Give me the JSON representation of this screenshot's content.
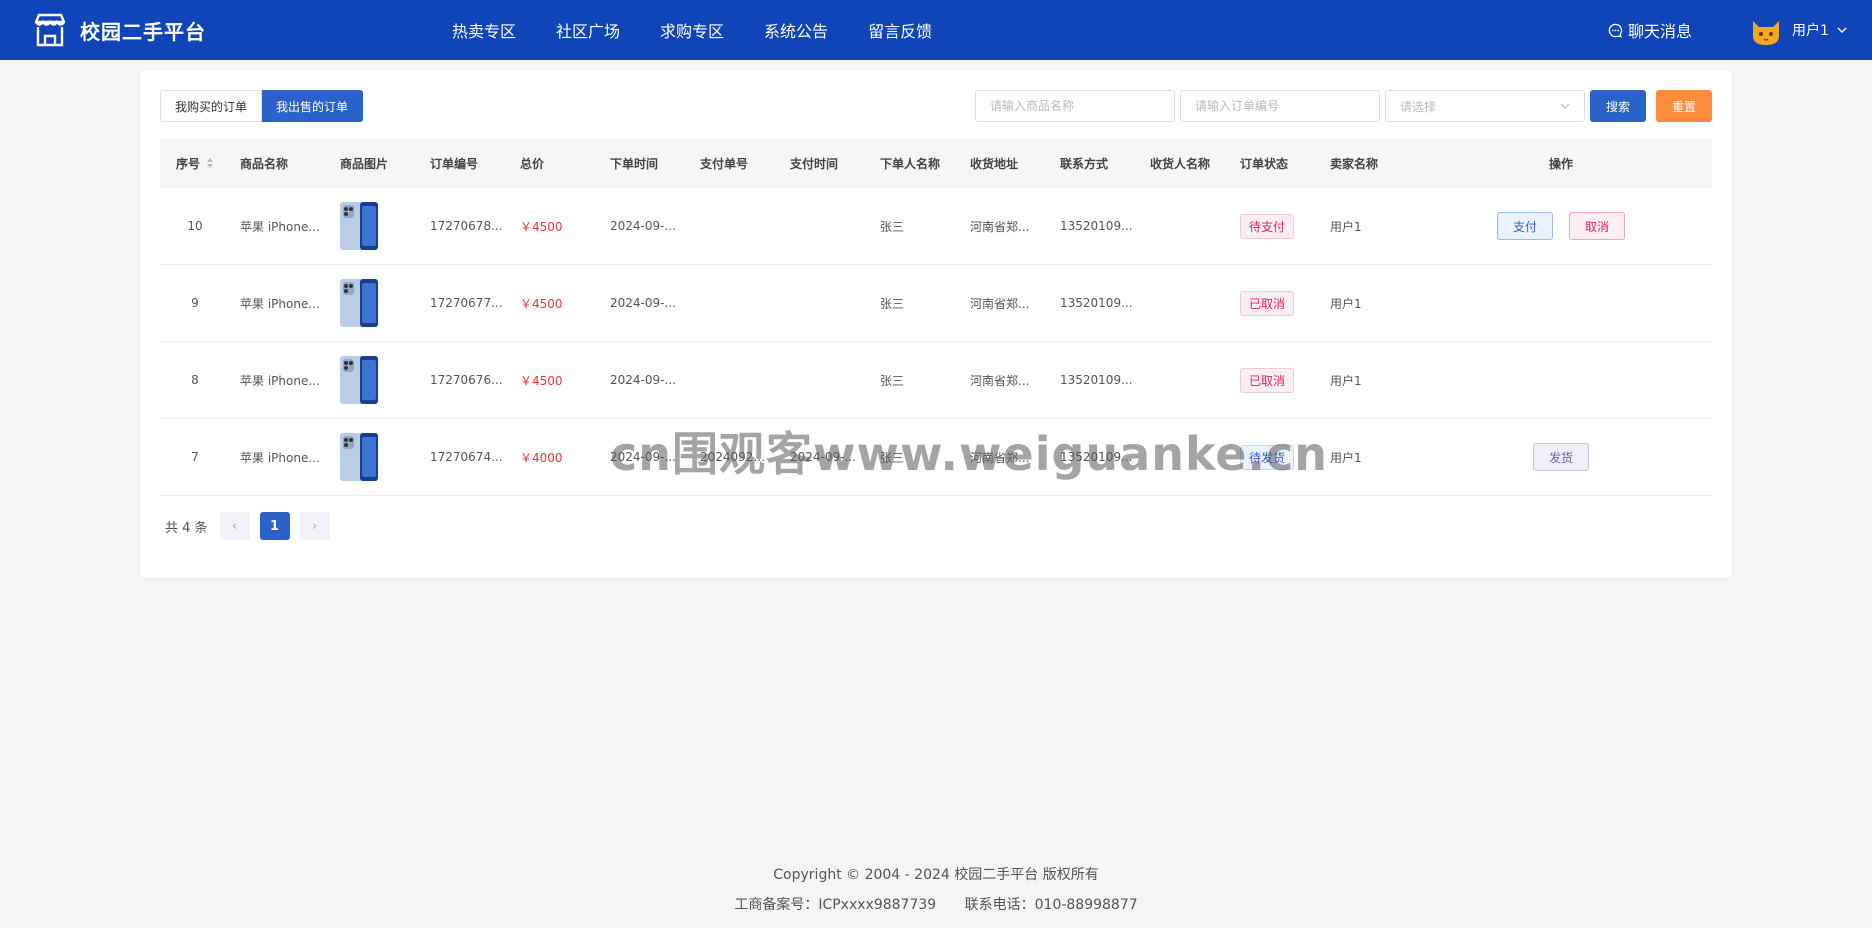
{
  "header": {
    "brand": "校园二手平台",
    "nav": [
      "热卖专区",
      "社区广场",
      "求购专区",
      "系统公告",
      "留言反馈"
    ],
    "chat_label": "聊天消息",
    "user_name": "用户1",
    "colors": {
      "bar": "#0f45b8",
      "primary": "#2a62c9",
      "reset": "#ff8b3d",
      "price": "#e53935"
    }
  },
  "tabs": {
    "bought": "我购买的订单",
    "sold": "我出售的订单",
    "active": "sold"
  },
  "filters": {
    "product_placeholder": "请输入商品名称",
    "order_placeholder": "请输入订单编号",
    "select_placeholder": "请选择",
    "search_label": "搜索",
    "reset_label": "重置"
  },
  "table": {
    "columns": [
      "序号",
      "商品名称",
      "商品图片",
      "订单编号",
      "总价",
      "下单时间",
      "支付单号",
      "支付时间",
      "下单人名称",
      "收货地址",
      "联系方式",
      "收货人名称",
      "订单状态",
      "卖家名称",
      "操作"
    ],
    "rows": [
      {
        "no": "10",
        "name": "苹果 iPhone...",
        "order": "17270678...",
        "total": "￥4500",
        "otime": "2024-09-...",
        "payno": "",
        "ptime": "",
        "buyer": "张三",
        "addr": "河南省郑...",
        "phone": "13520109...",
        "recv": "",
        "status": "待支付",
        "seller": "用户1",
        "ops": [
          "支付",
          "取消"
        ]
      },
      {
        "no": "9",
        "name": "苹果 iPhone...",
        "order": "17270677...",
        "total": "￥4500",
        "otime": "2024-09-...",
        "payno": "",
        "ptime": "",
        "buyer": "张三",
        "addr": "河南省郑...",
        "phone": "13520109...",
        "recv": "",
        "status": "已取消",
        "seller": "用户1",
        "ops": []
      },
      {
        "no": "8",
        "name": "苹果 iPhone...",
        "order": "17270676...",
        "total": "￥4500",
        "otime": "2024-09-...",
        "payno": "",
        "ptime": "",
        "buyer": "张三",
        "addr": "河南省郑...",
        "phone": "13520109...",
        "recv": "",
        "status": "已取消",
        "seller": "用户1",
        "ops": []
      },
      {
        "no": "7",
        "name": "苹果 iPhone...",
        "order": "17270674...",
        "total": "￥4000",
        "otime": "2024-09-...",
        "payno": "2024092...",
        "ptime": "2024-09-...",
        "buyer": "张三",
        "addr": "河南省郑...",
        "phone": "13520109...",
        "recv": "",
        "status": "待发货",
        "seller": "用户1",
        "ops": [
          "发货"
        ]
      }
    ]
  },
  "pagination": {
    "total_label": "共 4 条",
    "current": "1",
    "prev": "‹",
    "next": "›"
  },
  "watermark": "cn围观客www.weiguanke.cn",
  "footer": {
    "copyright": "Copyright © 2004 - 2024 校园二手平台 版权所有",
    "icp": "工商备案号：ICPxxxx9887739",
    "contact": "联系电话：010-88998877"
  }
}
